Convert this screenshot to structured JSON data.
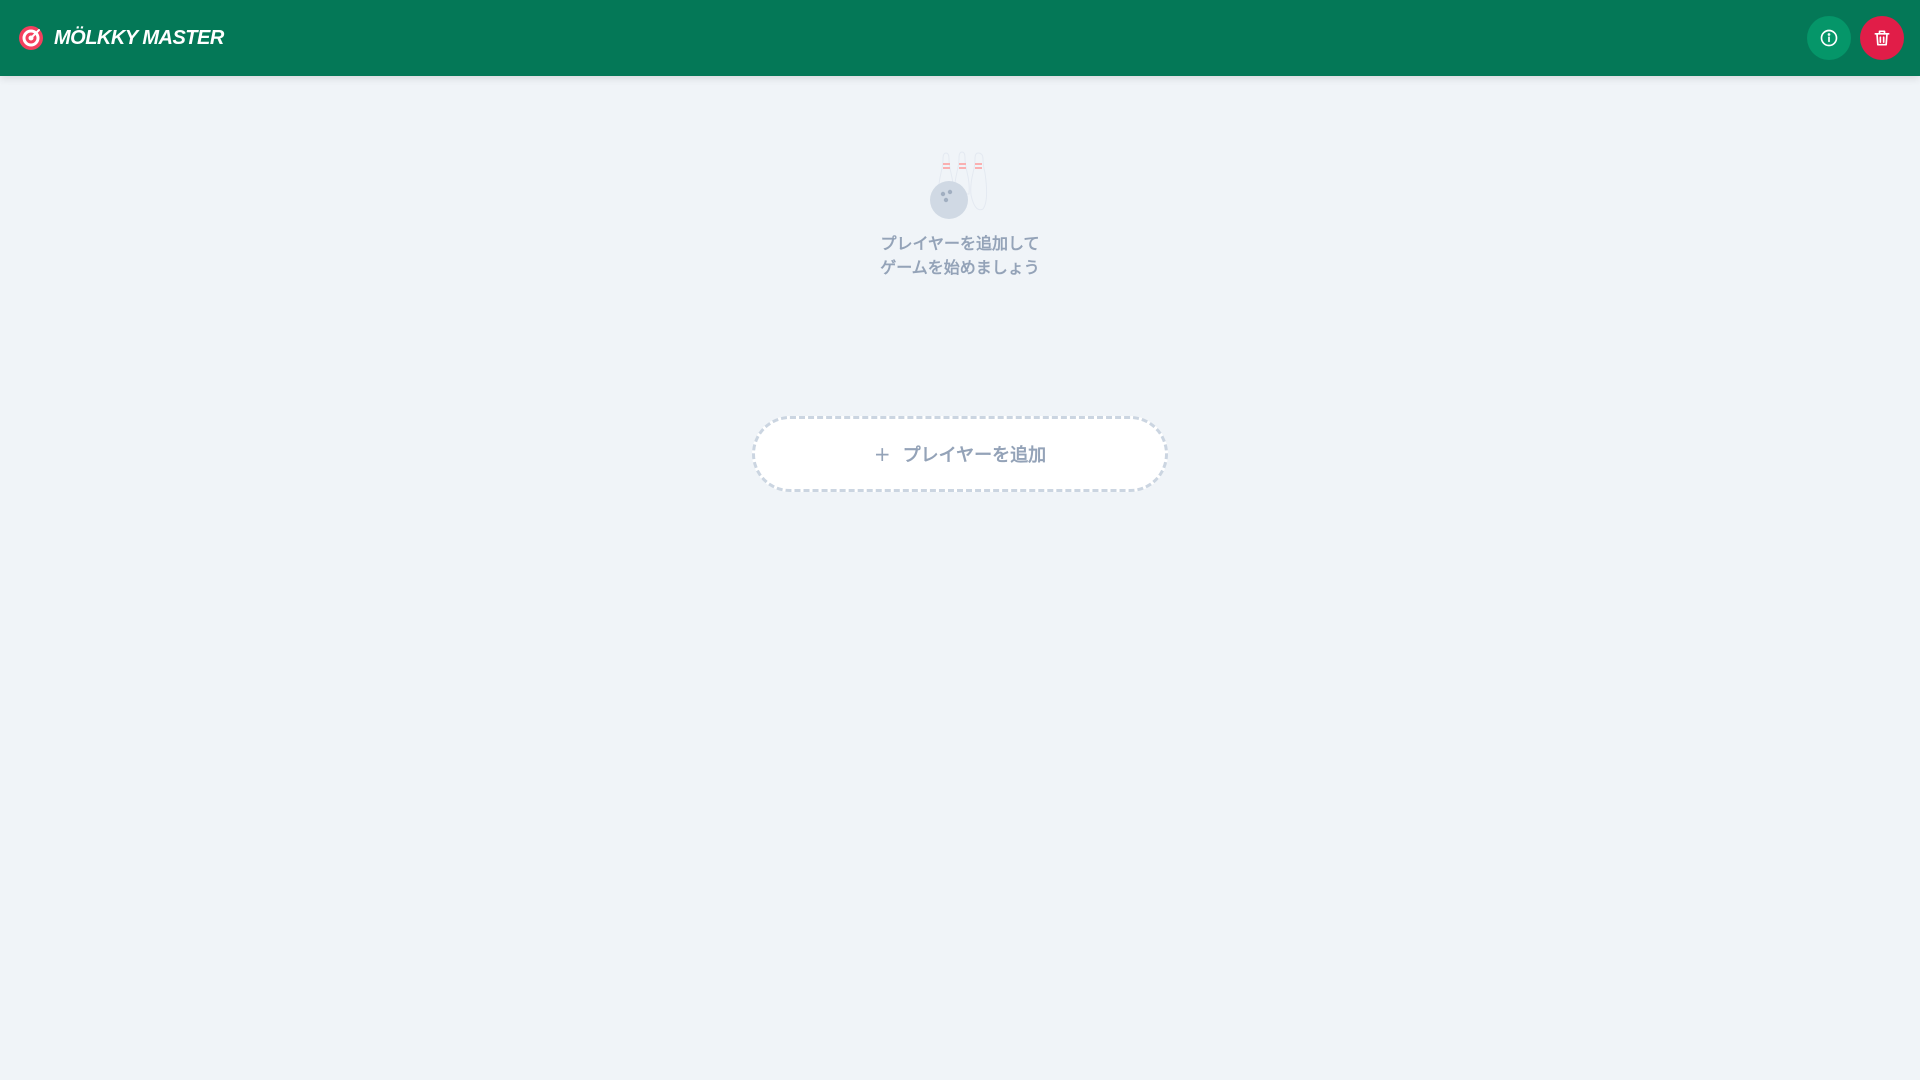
{
  "header": {
    "title": "MÖLKKY MASTER",
    "logo_icon": "target-icon",
    "actions": {
      "info_icon": "info-icon",
      "trash_icon": "trash-icon"
    }
  },
  "empty_state": {
    "icon": "bowling-icon",
    "line1": "プレイヤーを追加して",
    "line2": "ゲームを始めましょう"
  },
  "add_player": {
    "icon": "plus-icon",
    "plus": "+",
    "label": "プレイヤーを追加"
  },
  "colors": {
    "header_bg": "#047857",
    "info_button": "#059669",
    "trash_button": "#e11d48",
    "page_bg": "#f0f4f8",
    "muted_text": "#94a3b8"
  }
}
